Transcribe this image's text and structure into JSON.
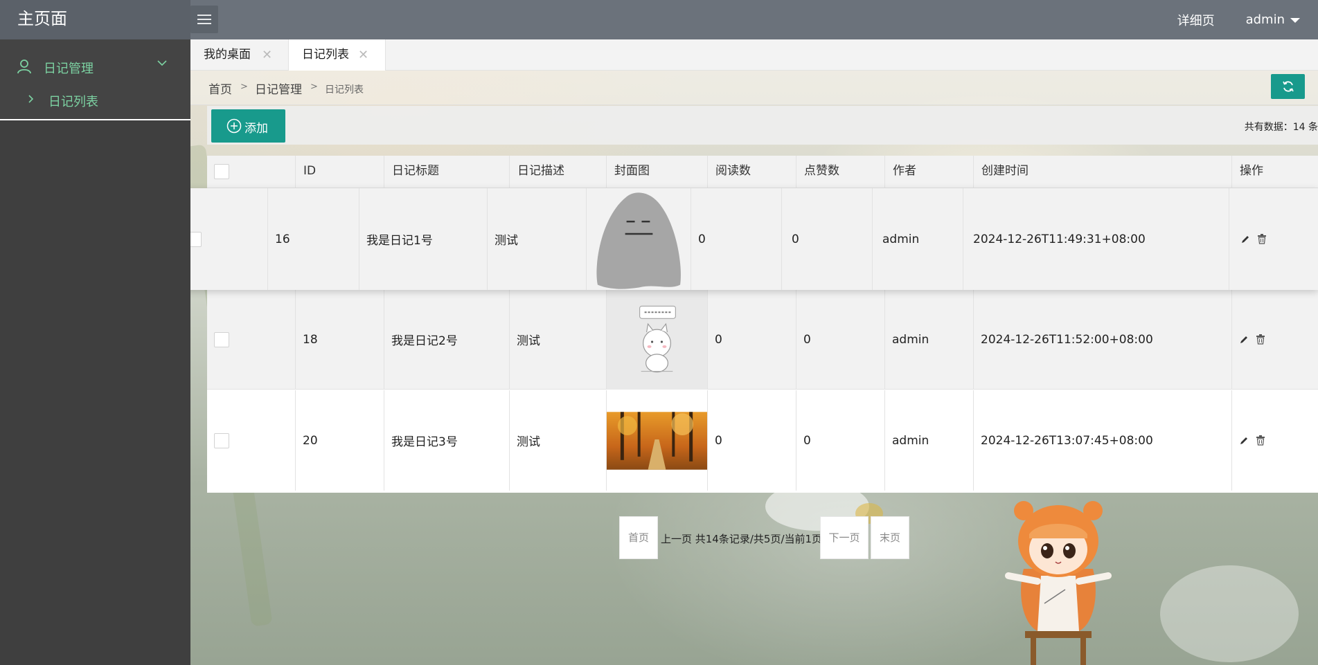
{
  "header": {
    "logo": "主页面",
    "detail_link": "详细页",
    "user": "admin"
  },
  "sidebar": {
    "group_label": "日记管理",
    "items": [
      {
        "label": "日记列表"
      }
    ]
  },
  "tabs": [
    {
      "label": "我的桌面",
      "close": "✕"
    },
    {
      "label": "日记列表",
      "close": "✕"
    }
  ],
  "breadcrumb": {
    "home": "首页",
    "sep": ">",
    "parent": "日记管理",
    "current": "日记列表"
  },
  "toolbar": {
    "add_label": "添加",
    "total_text": "共有数据：14 条"
  },
  "table": {
    "columns": [
      "ID",
      "日记标题",
      "日记描述",
      "封面图",
      "阅读数",
      "点赞数",
      "作者",
      "创建时间",
      "操作"
    ],
    "rows": [
      {
        "id": "16",
        "title": "我是日记1号",
        "desc": "测试",
        "cover": "grey-ghost",
        "reads": "0",
        "likes": "0",
        "author": "admin",
        "created": "2024-12-26T11:49:31+08:00"
      },
      {
        "id": "18",
        "title": "我是日记2号",
        "desc": "测试",
        "cover": "cartoon-cat",
        "reads": "0",
        "likes": "0",
        "author": "admin",
        "created": "2024-12-26T11:52:00+08:00"
      },
      {
        "id": "20",
        "title": "我是日记3号",
        "desc": "测试",
        "cover": "autumn-forest",
        "reads": "0",
        "likes": "0",
        "author": "admin",
        "created": "2024-12-26T13:07:45+08:00"
      }
    ]
  },
  "pagination": {
    "first": "首页",
    "info": "上一页 共14条记录/共5页/当前1页",
    "next": "下一页",
    "last": "末页"
  },
  "colors": {
    "accent": "#189a8c",
    "sidebar_text": "#7cd2a2",
    "topbar": "#6b727b"
  }
}
